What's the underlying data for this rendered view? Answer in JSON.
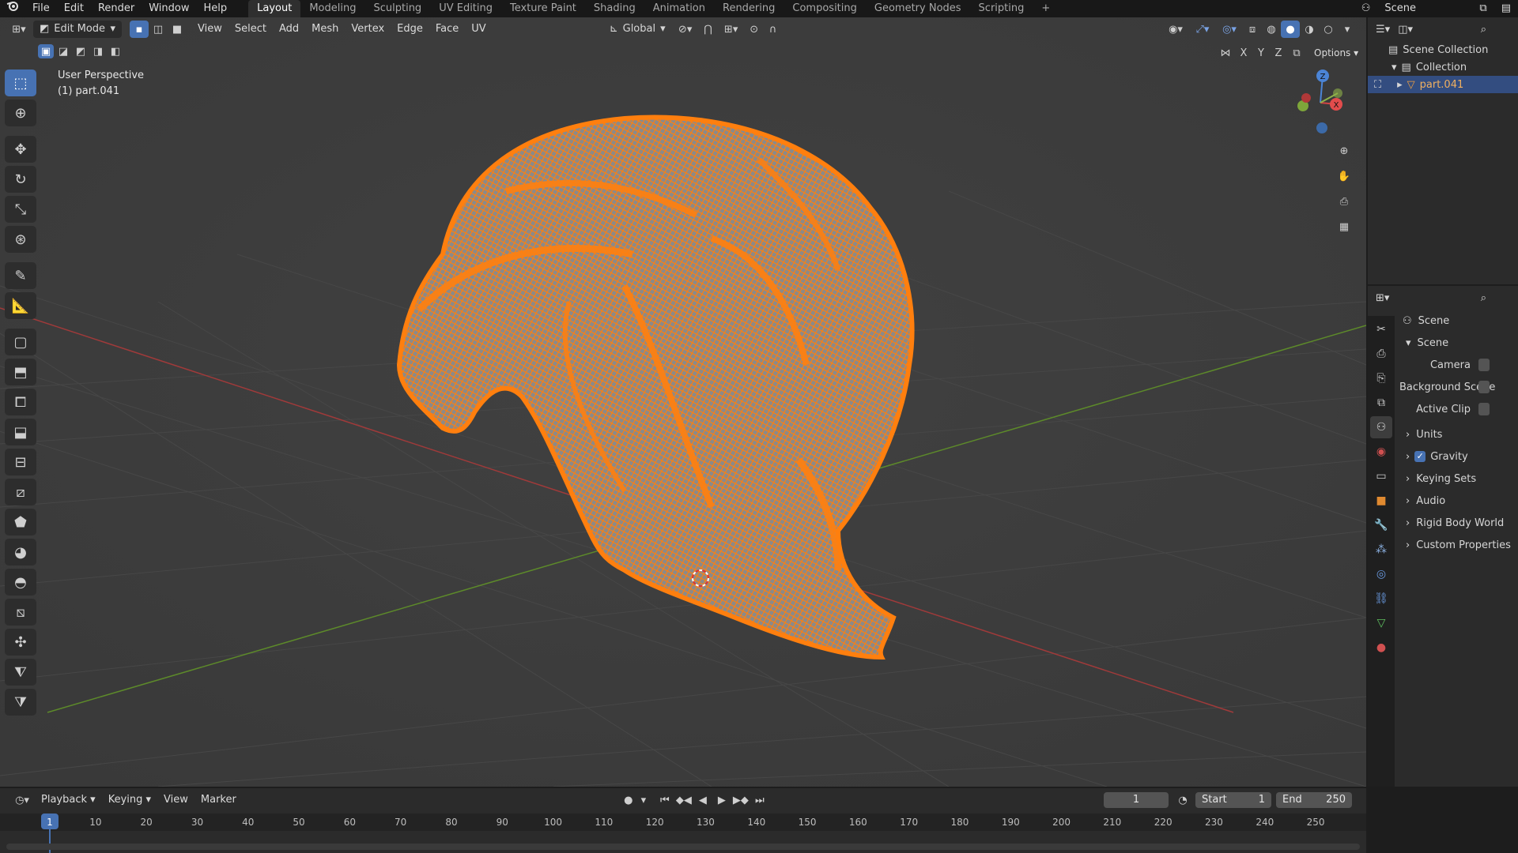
{
  "topbar": {
    "menus": [
      "File",
      "Edit",
      "Render",
      "Window",
      "Help"
    ],
    "workspaces": [
      "Layout",
      "Modeling",
      "Sculpting",
      "UV Editing",
      "Texture Paint",
      "Shading",
      "Animation",
      "Rendering",
      "Compositing",
      "Geometry Nodes",
      "Scripting"
    ],
    "active_workspace": "Layout",
    "scene_label": "Scene"
  },
  "viewport": {
    "mode": "Edit Mode",
    "menus": [
      "View",
      "Select",
      "Add",
      "Mesh",
      "Vertex",
      "Edge",
      "Face",
      "UV"
    ],
    "orientation": "Global",
    "options_label": "Options",
    "axis_x": "X",
    "axis_y": "Y",
    "axis_z": "Z",
    "overlay_title": "User Perspective",
    "overlay_object": "(1) part.041",
    "gizmo_z": "Z",
    "gizmo_x": "X"
  },
  "outliner": {
    "root": "Scene Collection",
    "collection": "Collection",
    "object": "part.041"
  },
  "properties": {
    "header": "Scene",
    "panel": "Scene",
    "fields": [
      {
        "label": "Camera"
      },
      {
        "label": "Background Scene"
      },
      {
        "label": "Active Clip"
      }
    ],
    "sections": [
      "Units",
      "Gravity",
      "Keying Sets",
      "Audio",
      "Rigid Body World",
      "Custom Properties"
    ],
    "gravity_checked": true
  },
  "timeline": {
    "menus": [
      "Playback",
      "Keying",
      "View",
      "Marker"
    ],
    "current_frame": "1",
    "start_label": "Start",
    "start_value": "1",
    "end_label": "End",
    "end_value": "250",
    "ruler": [
      "1",
      "10",
      "20",
      "30",
      "40",
      "50",
      "60",
      "70",
      "80",
      "90",
      "100",
      "110",
      "120",
      "130",
      "140",
      "150",
      "160",
      "170",
      "180",
      "190",
      "200",
      "210",
      "220",
      "230",
      "240",
      "250"
    ]
  },
  "colors": {
    "accent": "#4772b3",
    "mesh": "#ff7f0e",
    "x_axis": "#a03a3a",
    "y_axis": "#5d8a2a"
  }
}
